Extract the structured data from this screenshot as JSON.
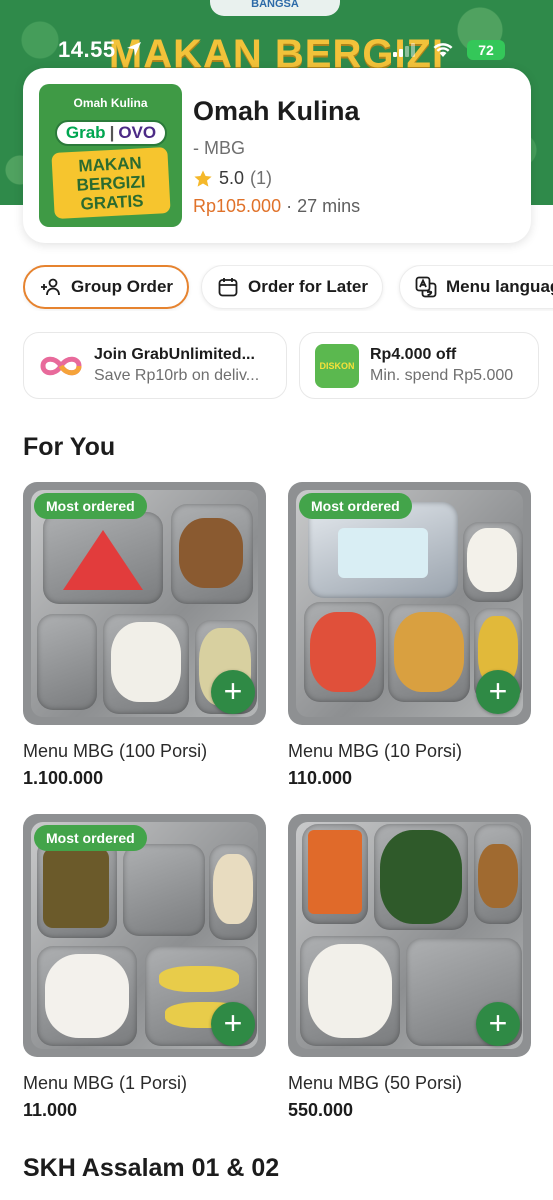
{
  "status_bar": {
    "time": "14.55",
    "battery": "72"
  },
  "banner": {
    "ribbon_text": "BANGSA",
    "title": "MAKAN BERGIZI"
  },
  "store": {
    "logo": {
      "top_text": "Omah Kulina",
      "brand_left": "Grab",
      "brand_right": "OVO",
      "line1": "MAKAN",
      "line2": "BERGIZI",
      "line3": "GRATIS"
    },
    "name": "Omah Kulina",
    "subtitle": "- MBG",
    "rating": "5.0",
    "rating_count": "(1)",
    "price": "Rp105.000",
    "eta": " · 27 mins"
  },
  "chips": [
    {
      "label": "Group Order",
      "icon": "group-add-icon",
      "active": true
    },
    {
      "label": "Order for Later",
      "icon": "calendar-icon",
      "active": false
    },
    {
      "label": "Menu languag",
      "icon": "translate-icon",
      "active": false
    }
  ],
  "promos": [
    {
      "title": "Join GrabUnlimited...",
      "subtitle": "Save Rp10rb on deliv...",
      "icon": "grab-unlimited-icon"
    },
    {
      "title": "Rp4.000 off",
      "subtitle": "Min. spend Rp5.000",
      "icon": "diskon-icon",
      "icon_text": "DISKON"
    }
  ],
  "sections": {
    "for_you": "For You",
    "next": "SKH Assalam 01 & 02"
  },
  "items": [
    {
      "name": "Menu MBG (100 Porsi)",
      "price": "1.100.000",
      "badge": "Most ordered"
    },
    {
      "name": "Menu MBG (10 Porsi)",
      "price": "110.000",
      "badge": "Most ordered"
    },
    {
      "name": "Menu MBG (1 Porsi)",
      "price": "11.000",
      "badge": "Most ordered"
    },
    {
      "name": "Menu MBG (50 Porsi)",
      "price": "550.000",
      "badge": ""
    }
  ],
  "add_symbol": "+",
  "colors": {
    "brand_green": "#2f8a45",
    "badge_green": "#43a44a",
    "price_orange": "#e0722a",
    "active_chip_border": "#e6832f"
  }
}
